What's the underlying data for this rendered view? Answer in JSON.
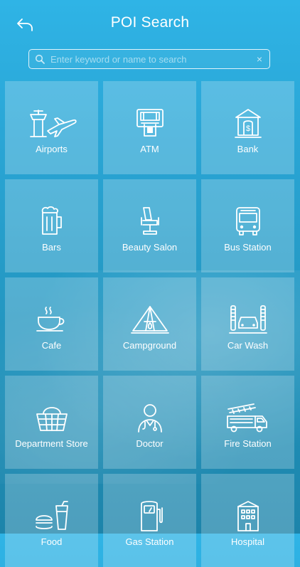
{
  "header": {
    "title": "POI Search",
    "back_icon": "back-arrow-icon"
  },
  "search": {
    "placeholder": "Enter keyword or name to search",
    "value": "",
    "clear_label": "×"
  },
  "categories": [
    {
      "label": "Airports",
      "icon": "airport-icon"
    },
    {
      "label": "ATM",
      "icon": "atm-icon"
    },
    {
      "label": "Bank",
      "icon": "bank-icon"
    },
    {
      "label": "Bars",
      "icon": "beer-mug-icon"
    },
    {
      "label": "Beauty Salon",
      "icon": "salon-chair-icon"
    },
    {
      "label": "Bus Station",
      "icon": "bus-icon"
    },
    {
      "label": "Cafe",
      "icon": "coffee-cup-icon"
    },
    {
      "label": "Campground",
      "icon": "tent-icon"
    },
    {
      "label": "Car Wash",
      "icon": "car-wash-icon"
    },
    {
      "label": "Department Store",
      "icon": "shopping-basket-icon"
    },
    {
      "label": "Doctor",
      "icon": "doctor-icon"
    },
    {
      "label": "Fire Station",
      "icon": "fire-truck-icon"
    },
    {
      "label": "Food",
      "icon": "fast-food-icon"
    },
    {
      "label": "Gas Station",
      "icon": "gas-pump-icon"
    },
    {
      "label": "Hospital",
      "icon": "hospital-icon"
    }
  ],
  "colors": {
    "background_top": "#2fb4e6",
    "background_bottom": "#1d84aa",
    "tile": "rgba(255,255,255,0.22)"
  }
}
